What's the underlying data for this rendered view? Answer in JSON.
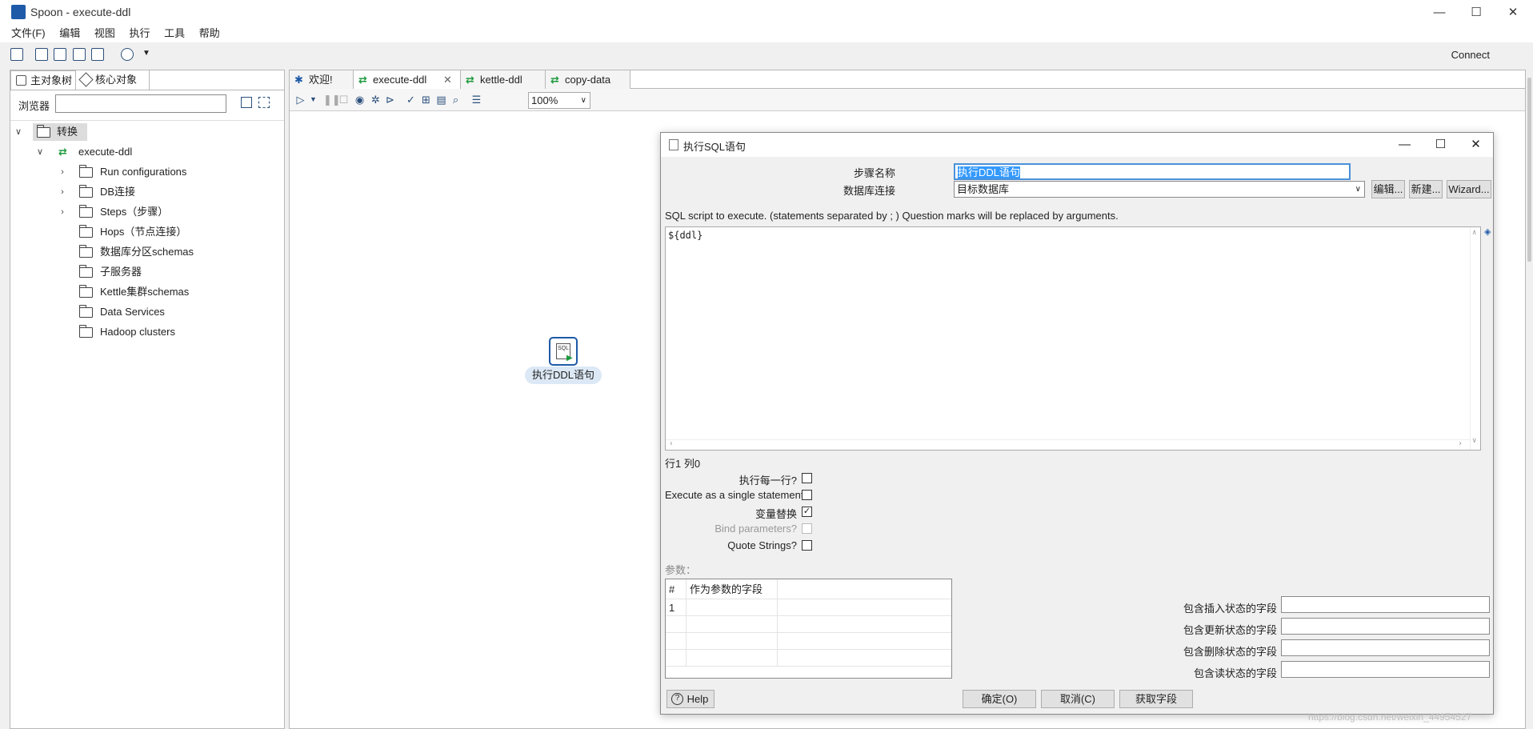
{
  "window": {
    "title": "Spoon - execute-ddl",
    "min": "—",
    "max": "☐",
    "close": "✕"
  },
  "menu": [
    "文件(F)",
    "编辑",
    "视图",
    "执行",
    "工具",
    "帮助"
  ],
  "connect_label": "Connect",
  "left_tabs": [
    "主对象树",
    "核心对象"
  ],
  "browser": {
    "label": "浏览器",
    "value": ""
  },
  "tree": {
    "root": "转换",
    "transform": "execute-ddl",
    "children": [
      "Run configurations",
      "DB连接",
      "Steps（步骤）",
      "Hops（节点连接）",
      "数据库分区schemas",
      "子服务器",
      "Kettle集群schemas",
      "Data Services",
      "Hadoop clusters"
    ]
  },
  "tabs": [
    "欢迎!",
    "execute-ddl",
    "kettle-ddl",
    "copy-data"
  ],
  "zoom": "100%",
  "step_label": "执行DDL语句",
  "dialog": {
    "title": "执行SQL语句",
    "step_name_label": "步骤名称",
    "step_name_value": "执行DDL语句",
    "db_label": "数据库连接",
    "db_value": "目标数据库",
    "edit": "编辑...",
    "new": "新建...",
    "wizard": "Wizard...",
    "sql_hint": "SQL script to execute. (statements separated by ; ) Question marks will be replaced by arguments.",
    "sql": "${ddl}",
    "pos": "行1 列0",
    "checks": [
      {
        "label": "执行每一行?",
        "checked": false,
        "disabled": false
      },
      {
        "label": "Execute as a single statement",
        "checked": false,
        "disabled": false
      },
      {
        "label": "变量替换",
        "checked": true,
        "disabled": false
      },
      {
        "label": "Bind parameters?",
        "checked": false,
        "disabled": true
      },
      {
        "label": "Quote Strings?",
        "checked": false,
        "disabled": false
      }
    ],
    "params_label": "参数：",
    "param_head": [
      "#",
      "作为参数的字段"
    ],
    "param_row": "1",
    "status_fields": [
      "包含插入状态的字段",
      "包含更新状态的字段",
      "包含删除状态的字段",
      "包含读状态的字段"
    ],
    "help": "Help",
    "ok": "确定(O)",
    "cancel": "取消(C)",
    "get_fields": "获取字段"
  },
  "watermark": "https://blog.csdn.net/weixin_44954527"
}
